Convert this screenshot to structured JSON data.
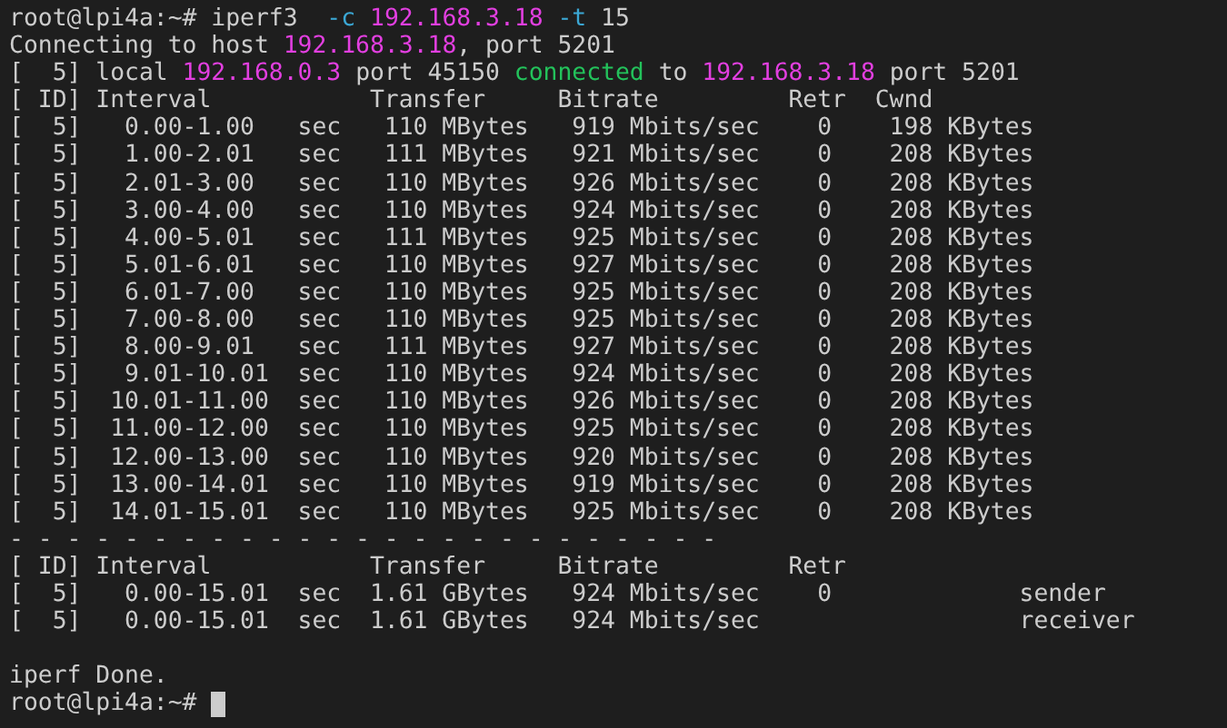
{
  "terminal": {
    "lines": [
      {
        "segments": [
          {
            "kind": "plain",
            "text": "root@lpi4a:~# iperf3  "
          },
          {
            "kind": "option",
            "text": "-c "
          },
          {
            "kind": "address",
            "text": "192.168.3.18"
          },
          {
            "kind": "option",
            "text": " -t"
          },
          {
            "kind": "plain",
            "text": " 15"
          }
        ]
      },
      {
        "segments": [
          {
            "kind": "plain",
            "text": "Connecting to host "
          },
          {
            "kind": "address",
            "text": "192.168.3.18"
          },
          {
            "kind": "plain",
            "text": ", port 5201"
          }
        ]
      },
      {
        "segments": [
          {
            "kind": "plain",
            "text": "[  5] local "
          },
          {
            "kind": "address",
            "text": "192.168.0.3"
          },
          {
            "kind": "plain",
            "text": " port 45150 "
          },
          {
            "kind": "connected",
            "text": "connected"
          },
          {
            "kind": "plain",
            "text": " to "
          },
          {
            "kind": "address",
            "text": "192.168.3.18"
          },
          {
            "kind": "plain",
            "text": " port 5201"
          }
        ]
      },
      {
        "segments": [
          {
            "kind": "plain",
            "text": "[ ID] Interval           Transfer     Bitrate         Retr  Cwnd"
          }
        ]
      },
      {
        "segments": [
          {
            "kind": "plain",
            "text": "[  5]   0.00-1.00   sec   110 MBytes   919 Mbits/sec    0    198 KBytes"
          }
        ]
      },
      {
        "segments": [
          {
            "kind": "plain",
            "text": "[  5]   1.00-2.01   sec   111 MBytes   921 Mbits/sec    0    208 KBytes"
          }
        ]
      },
      {
        "segments": [
          {
            "kind": "plain",
            "text": "[  5]   2.01-3.00   sec   110 MBytes   926 Mbits/sec    0    208 KBytes"
          }
        ]
      },
      {
        "segments": [
          {
            "kind": "plain",
            "text": "[  5]   3.00-4.00   sec   110 MBytes   924 Mbits/sec    0    208 KBytes"
          }
        ]
      },
      {
        "segments": [
          {
            "kind": "plain",
            "text": "[  5]   4.00-5.01   sec   111 MBytes   925 Mbits/sec    0    208 KBytes"
          }
        ]
      },
      {
        "segments": [
          {
            "kind": "plain",
            "text": "[  5]   5.01-6.01   sec   110 MBytes   927 Mbits/sec    0    208 KBytes"
          }
        ]
      },
      {
        "segments": [
          {
            "kind": "plain",
            "text": "[  5]   6.01-7.00   sec   110 MBytes   925 Mbits/sec    0    208 KBytes"
          }
        ]
      },
      {
        "segments": [
          {
            "kind": "plain",
            "text": "[  5]   7.00-8.00   sec   110 MBytes   925 Mbits/sec    0    208 KBytes"
          }
        ]
      },
      {
        "segments": [
          {
            "kind": "plain",
            "text": "[  5]   8.00-9.01   sec   111 MBytes   927 Mbits/sec    0    208 KBytes"
          }
        ]
      },
      {
        "segments": [
          {
            "kind": "plain",
            "text": "[  5]   9.01-10.01  sec   110 MBytes   924 Mbits/sec    0    208 KBytes"
          }
        ]
      },
      {
        "segments": [
          {
            "kind": "plain",
            "text": "[  5]  10.01-11.00  sec   110 MBytes   926 Mbits/sec    0    208 KBytes"
          }
        ]
      },
      {
        "segments": [
          {
            "kind": "plain",
            "text": "[  5]  11.00-12.00  sec   110 MBytes   925 Mbits/sec    0    208 KBytes"
          }
        ]
      },
      {
        "segments": [
          {
            "kind": "plain",
            "text": "[  5]  12.00-13.00  sec   110 MBytes   920 Mbits/sec    0    208 KBytes"
          }
        ]
      },
      {
        "segments": [
          {
            "kind": "plain",
            "text": "[  5]  13.00-14.01  sec   110 MBytes   919 Mbits/sec    0    208 KBytes"
          }
        ]
      },
      {
        "segments": [
          {
            "kind": "plain",
            "text": "[  5]  14.01-15.01  sec   110 MBytes   925 Mbits/sec    0    208 KBytes"
          }
        ]
      },
      {
        "segments": [
          {
            "kind": "plain",
            "text": "- - - - - - - - - - - - - - - - - - - - - - - - -"
          }
        ]
      },
      {
        "segments": [
          {
            "kind": "plain",
            "text": "[ ID] Interval           Transfer     Bitrate         Retr"
          }
        ]
      },
      {
        "segments": [
          {
            "kind": "plain",
            "text": "[  5]   0.00-15.01  sec  1.61 GBytes   924 Mbits/sec    0             sender"
          }
        ]
      },
      {
        "segments": [
          {
            "kind": "plain",
            "text": "[  5]   0.00-15.01  sec  1.61 GBytes   924 Mbits/sec                  receiver"
          }
        ]
      },
      {
        "segments": [
          {
            "kind": "plain",
            "text": "iperf Done."
          }
        ],
        "blank_before": true
      },
      {
        "segments": [
          {
            "kind": "plain",
            "text": "root@lpi4a:~# "
          }
        ],
        "cursor": true
      }
    ]
  }
}
